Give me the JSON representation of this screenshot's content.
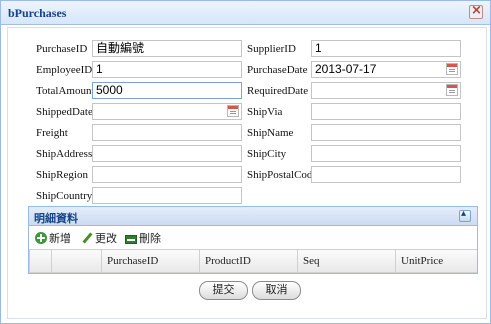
{
  "window": {
    "title": "bPurchases"
  },
  "form": {
    "purchase_id": {
      "label": "PurchaseID",
      "value": "自動編號"
    },
    "supplier_id": {
      "label": "SupplierID",
      "value": "1"
    },
    "employee_id": {
      "label": "EmployeeID",
      "value": "1"
    },
    "purchase_date": {
      "label": "PurchaseDate",
      "value": "2013-07-17"
    },
    "total_amount": {
      "label": "TotalAmount",
      "value": "5000"
    },
    "required_date": {
      "label": "RequiredDate",
      "value": ""
    },
    "shipped_date": {
      "label": "ShippedDate",
      "value": ""
    },
    "ship_via": {
      "label": "ShipVia",
      "value": ""
    },
    "freight": {
      "label": "Freight",
      "value": ""
    },
    "ship_name": {
      "label": "ShipName",
      "value": ""
    },
    "ship_address": {
      "label": "ShipAddress",
      "value": ""
    },
    "ship_city": {
      "label": "ShipCity",
      "value": ""
    },
    "ship_region": {
      "label": "ShipRegion",
      "value": ""
    },
    "ship_postal_code": {
      "label": "ShipPostalCode",
      "value": ""
    },
    "ship_country": {
      "label": "ShipCountry",
      "value": ""
    }
  },
  "detail": {
    "title": "明細資料",
    "toolbar": {
      "add": "新增",
      "edit": "更改",
      "delete": "刪除"
    },
    "columns": [
      "PurchaseID",
      "ProductID",
      "Seq",
      "UnitPrice"
    ]
  },
  "buttons": {
    "submit": "提交",
    "cancel": "取消"
  },
  "icons": {
    "close": "close-icon",
    "calendar": "calendar-icon",
    "collapse": "collapse-icon",
    "add": "add-icon",
    "edit": "pencil-icon",
    "delete": "delete-icon"
  }
}
